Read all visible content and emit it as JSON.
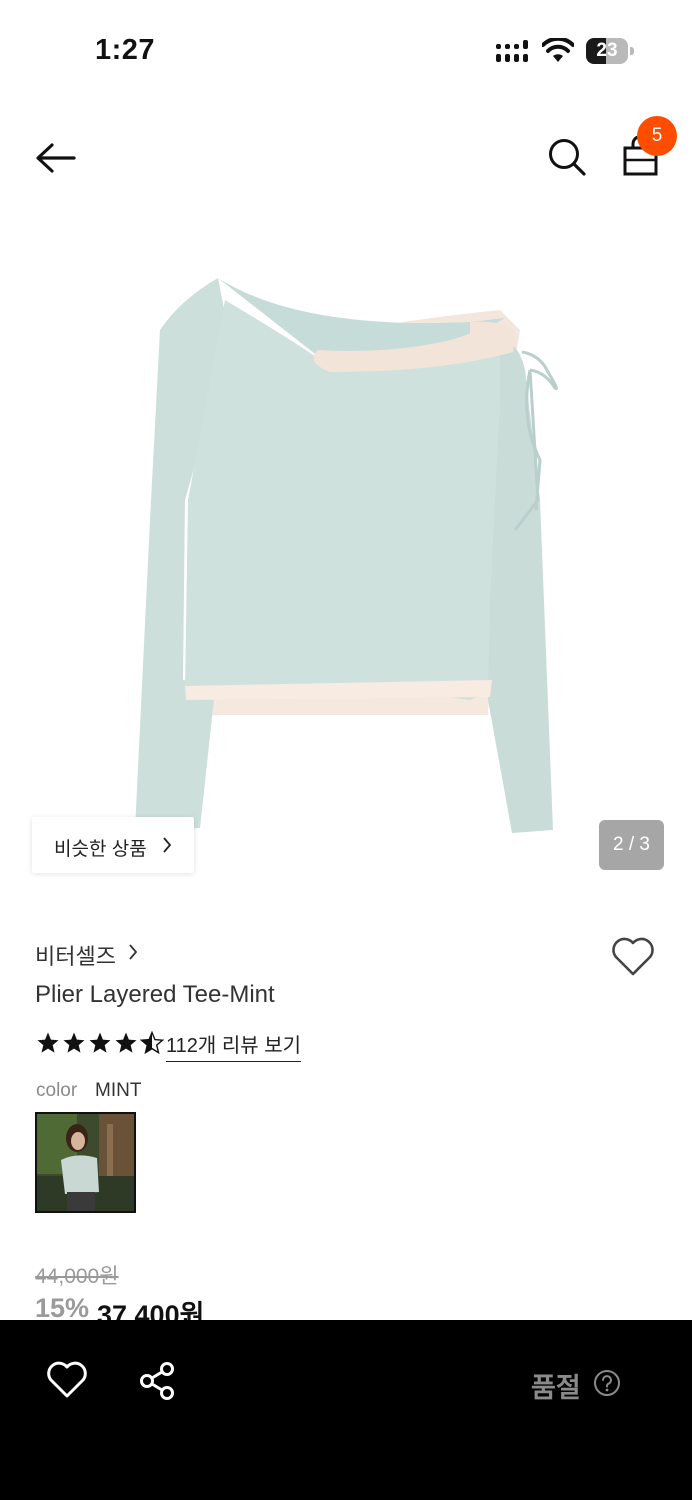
{
  "status_bar": {
    "time": "1:27",
    "battery": "23"
  },
  "header": {
    "back_icon": "arrow-left-icon",
    "search_icon": "search-icon",
    "cart_icon": "shopping-bag-icon",
    "cart_count": "5",
    "badge_color": "#ff4d00"
  },
  "gallery": {
    "similar_label": "비슷한 상품",
    "page_indicator": "2 / 3",
    "current_page": 2,
    "total_pages": 3
  },
  "product": {
    "brand": "비터셀즈",
    "title": "Plier Layered Tee-Mint",
    "rating": 4.5,
    "review_link": "112개 리뷰 보기",
    "color_label": "color",
    "color_value": "MINT",
    "original_price": "44,000원",
    "discount": "15%",
    "sale_price": "37,400원"
  },
  "bottom_bar": {
    "wishlist_icon": "heart-outline-icon",
    "share_icon": "share-icon",
    "status": "품절",
    "help_icon": "question-circle-icon"
  }
}
